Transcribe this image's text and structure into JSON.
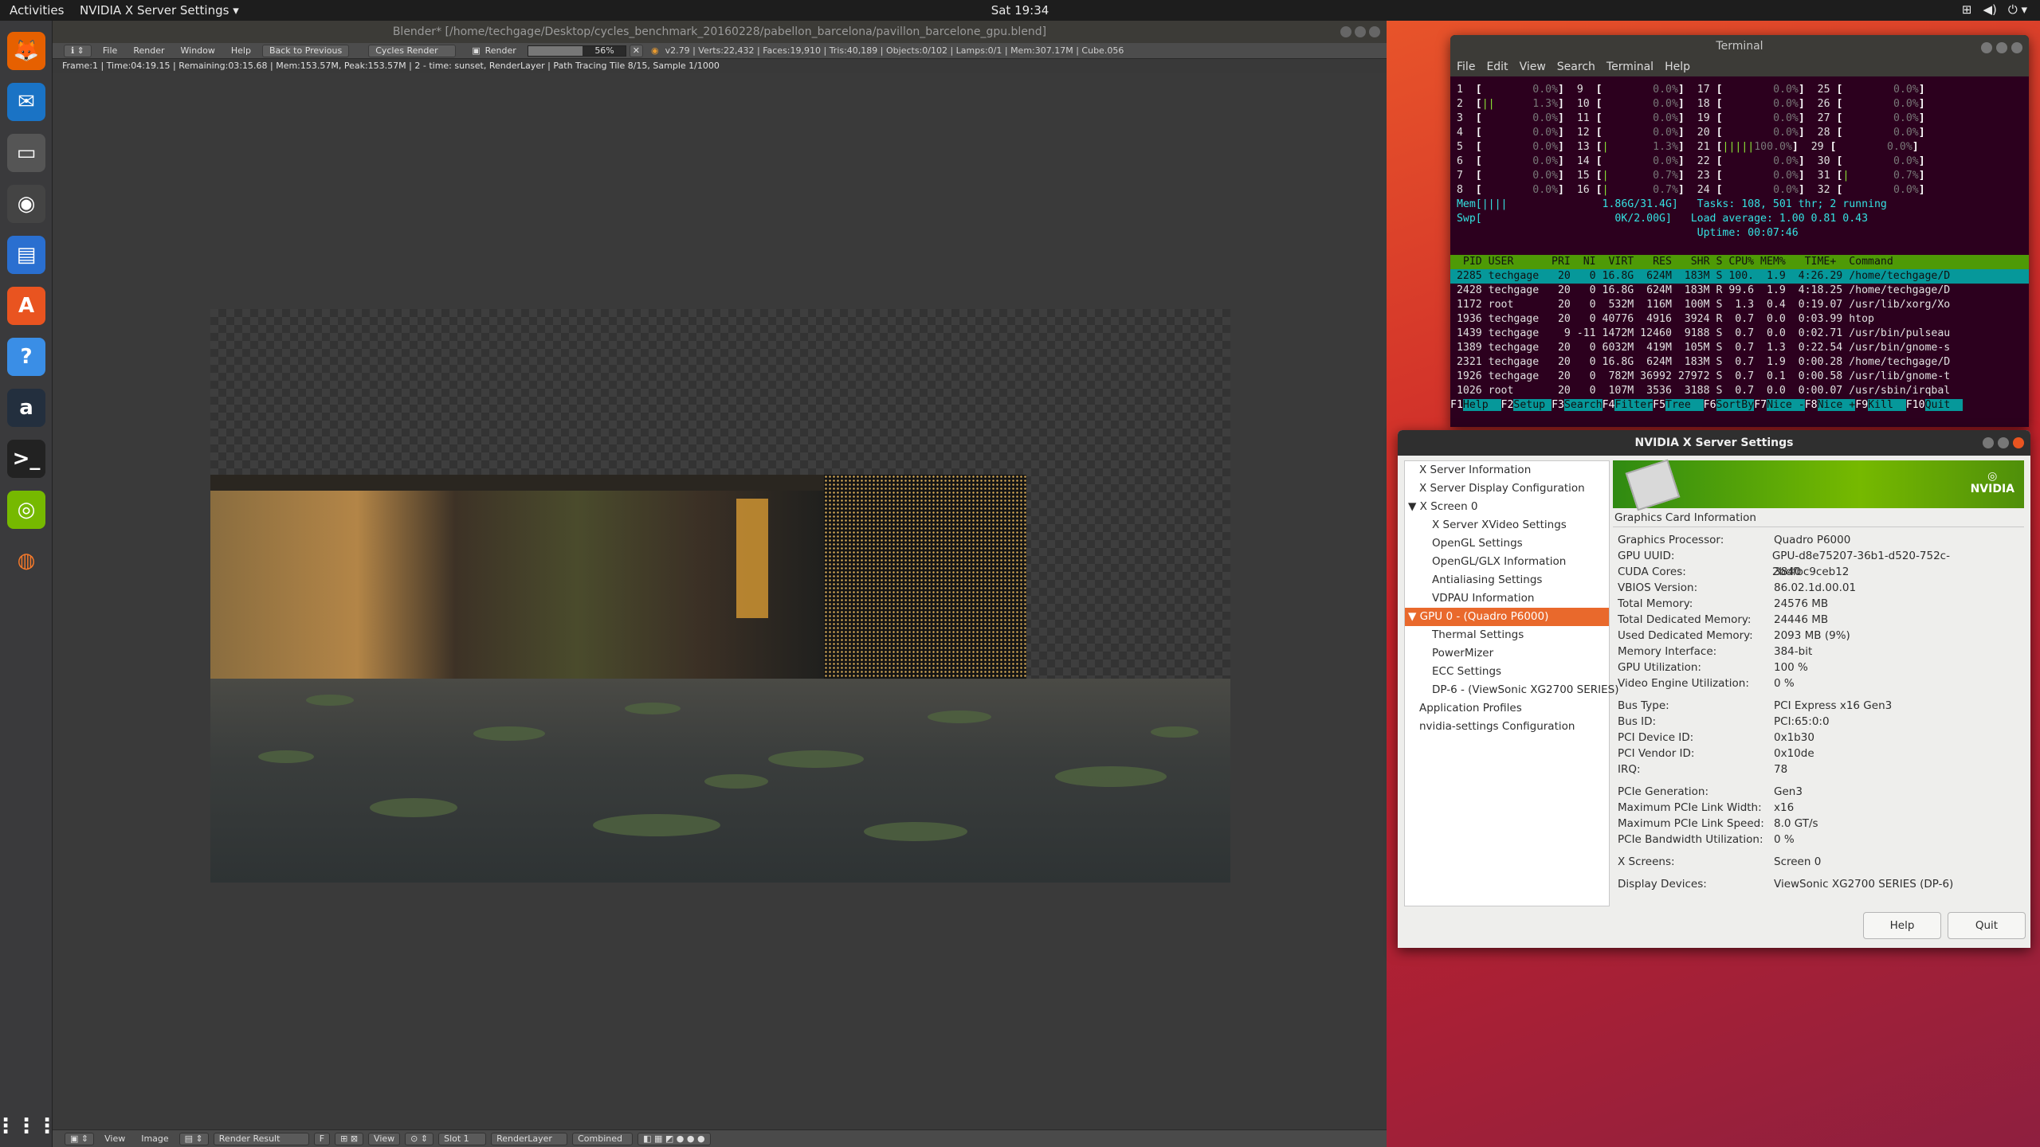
{
  "topbar": {
    "activities": "Activities",
    "app_menu": "NVIDIA X Server Settings ▾",
    "clock": "Sat 19:34"
  },
  "dock": [
    {
      "name": "firefox-icon",
      "glyph": "🦊"
    },
    {
      "name": "thunderbird-icon",
      "glyph": "✉"
    },
    {
      "name": "files-icon",
      "glyph": "▭"
    },
    {
      "name": "rhythmbox-icon",
      "glyph": "◉"
    },
    {
      "name": "writer-icon",
      "glyph": "▤"
    },
    {
      "name": "software-icon",
      "glyph": "A"
    },
    {
      "name": "help-icon",
      "glyph": "?"
    },
    {
      "name": "amazon-icon",
      "glyph": "a"
    },
    {
      "name": "terminal-icon",
      "glyph": ">_"
    },
    {
      "name": "nvidia-icon",
      "glyph": "◎"
    },
    {
      "name": "blender-icon",
      "glyph": "◍"
    },
    {
      "name": "show-apps-icon",
      "glyph": "⋮⋮⋮"
    }
  ],
  "blender": {
    "title": "Blender* [/home/techgage/Desktop/cycles_benchmark_20160228/pabellon_barcelona/pavillon_barcelone_gpu.blend]",
    "menus": [
      "File",
      "Render",
      "Window",
      "Help"
    ],
    "back": "Back to Previous",
    "engine": "Cycles Render",
    "render_label": "Render",
    "progress": "56%",
    "progress_value": 0.56,
    "info": "v2.79 | Verts:22,432 | Faces:19,910 | Tris:40,189 | Objects:0/102 | Lamps:0/1 | Mem:307.17M | Cube.056",
    "status": "Frame:1 | Time:04:19.15 | Remaining:03:15.68 | Mem:153.57M, Peak:153.57M | 2 - time: sunset, RenderLayer | Path Tracing Tile 8/15, Sample 1/1000",
    "footer": {
      "view": "View",
      "image": "Image",
      "result": "Render Result",
      "f": "F",
      "view2": "View",
      "slot": "Slot 1",
      "layer": "RenderLayer",
      "pass": "Combined"
    }
  },
  "terminal": {
    "title": "Terminal",
    "menus": [
      "File",
      "Edit",
      "View",
      "Search",
      "Terminal",
      "Help"
    ],
    "cpu_rows": [
      " 1  [        0.0%]  9  [        0.0%]  17 [        0.0%]  25 [        0.0%]",
      " 2  [||      1.3%]  10 [        0.0%]  18 [        0.0%]  26 [        0.0%]",
      " 3  [        0.0%]  11 [        0.0%]  19 [        0.0%]  27 [        0.0%]",
      " 4  [        0.0%]  12 [        0.0%]  20 [        0.0%]  28 [        0.0%]",
      " 5  [        0.0%]  13 [|       1.3%]  21 [|||||100.0%]  29 [        0.0%]",
      " 6  [        0.0%]  14 [        0.0%]  22 [        0.0%]  30 [        0.0%]",
      " 7  [        0.0%]  15 [|       0.7%]  23 [        0.0%]  31 [|       0.7%]",
      " 8  [        0.0%]  16 [|       0.7%]  24 [        0.0%]  32 [        0.0%]"
    ],
    "mem_line": " Mem[||||               1.86G/31.4G]   Tasks: 108, 501 thr; 2 running",
    "swp_line": " Swp[                     0K/2.00G]   Load average: 1.00 0.81 0.43",
    "uptime_line": "                                       Uptime: 00:07:46",
    "header": "  PID USER      PRI  NI  VIRT   RES   SHR S CPU% MEM%   TIME+  Command",
    "procs": [
      " 2285 techgage   20   0 16.8G  624M  183M S 100.  1.9  4:26.29 /home/techgage/D",
      " 2428 techgage   20   0 16.8G  624M  183M R 99.6  1.9  4:18.25 /home/techgage/D",
      " 1172 root       20   0  532M  116M  100M S  1.3  0.4  0:19.07 /usr/lib/xorg/Xo",
      " 1936 techgage   20   0 40776  4916  3924 R  0.7  0.0  0:03.99 htop",
      " 1439 techgage    9 -11 1472M 12460  9188 S  0.7  0.0  0:02.71 /usr/bin/pulseau",
      " 1389 techgage   20   0 6032M  419M  105M S  0.7  1.3  0:22.54 /usr/bin/gnome-s",
      " 2321 techgage   20   0 16.8G  624M  183M S  0.7  1.9  0:00.28 /home/techgage/D",
      " 1926 techgage   20   0  782M 36992 27972 S  0.7  0.1  0:00.58 /usr/lib/gnome-t",
      " 1026 root       20   0  107M  3536  3188 S  0.7  0.0  0:00.07 /usr/sbin/irqbal"
    ],
    "fkeys": [
      [
        "F1",
        "Help"
      ],
      [
        "F2",
        "Setup"
      ],
      [
        "F3",
        "Search"
      ],
      [
        "F4",
        "Filter"
      ],
      [
        "F5",
        "Tree"
      ],
      [
        "F6",
        "SortBy"
      ],
      [
        "F7",
        "Nice -"
      ],
      [
        "F8",
        "Nice +"
      ],
      [
        "F9",
        "Kill"
      ],
      [
        "F10",
        "Quit"
      ]
    ]
  },
  "nvidia": {
    "title": "NVIDIA X Server Settings",
    "tree": [
      {
        "label": "X Server Information",
        "indent": 1
      },
      {
        "label": "X Server Display Configuration",
        "indent": 1
      },
      {
        "label": "▼ X Screen 0",
        "indent": 0
      },
      {
        "label": "X Server XVideo Settings",
        "indent": 2
      },
      {
        "label": "OpenGL Settings",
        "indent": 2
      },
      {
        "label": "OpenGL/GLX Information",
        "indent": 2
      },
      {
        "label": "Antialiasing Settings",
        "indent": 2
      },
      {
        "label": "VDPAU Information",
        "indent": 2
      },
      {
        "label": "▼ GPU 0 - (Quadro P6000)",
        "indent": 0,
        "selected": true
      },
      {
        "label": "Thermal Settings",
        "indent": 2
      },
      {
        "label": "PowerMizer",
        "indent": 2
      },
      {
        "label": "ECC Settings",
        "indent": 2
      },
      {
        "label": "DP-6 - (ViewSonic XG2700 SERIES)",
        "indent": 2
      },
      {
        "label": "Application Profiles",
        "indent": 1
      },
      {
        "label": "nvidia-settings Configuration",
        "indent": 1
      }
    ],
    "logo": "NVIDIA",
    "group_title": "Graphics Card Information",
    "groups": [
      [
        [
          "Graphics Processor:",
          "Quadro P6000"
        ],
        [
          "GPU UUID:",
          "GPU-d8e75207-36b1-d520-752c-2bdfbc9ceb12"
        ],
        [
          "CUDA Cores:",
          "3840"
        ],
        [
          "VBIOS Version:",
          "86.02.1d.00.01"
        ],
        [
          "Total Memory:",
          "24576 MB"
        ],
        [
          "Total Dedicated Memory:",
          "24446 MB"
        ],
        [
          "Used Dedicated Memory:",
          "2093 MB (9%)"
        ],
        [
          "Memory Interface:",
          "384-bit"
        ],
        [
          "GPU Utilization:",
          "100 %"
        ],
        [
          "Video Engine Utilization:",
          "0 %"
        ]
      ],
      [
        [
          "Bus Type:",
          "PCI Express x16 Gen3"
        ],
        [
          "Bus ID:",
          "PCI:65:0:0"
        ],
        [
          "PCI Device ID:",
          "0x1b30"
        ],
        [
          "PCI Vendor ID:",
          "0x10de"
        ],
        [
          "IRQ:",
          "78"
        ]
      ],
      [
        [
          "PCIe Generation:",
          "Gen3"
        ],
        [
          "Maximum PCIe Link Width:",
          "x16"
        ],
        [
          "Maximum PCIe Link Speed:",
          "8.0 GT/s"
        ],
        [
          "PCIe Bandwidth Utilization:",
          "0 %"
        ]
      ],
      [
        [
          "X Screens:",
          "Screen 0"
        ]
      ],
      [
        [
          "Display Devices:",
          "ViewSonic XG2700 SERIES (DP-6)"
        ]
      ]
    ],
    "help": "Help",
    "quit": "Quit"
  }
}
